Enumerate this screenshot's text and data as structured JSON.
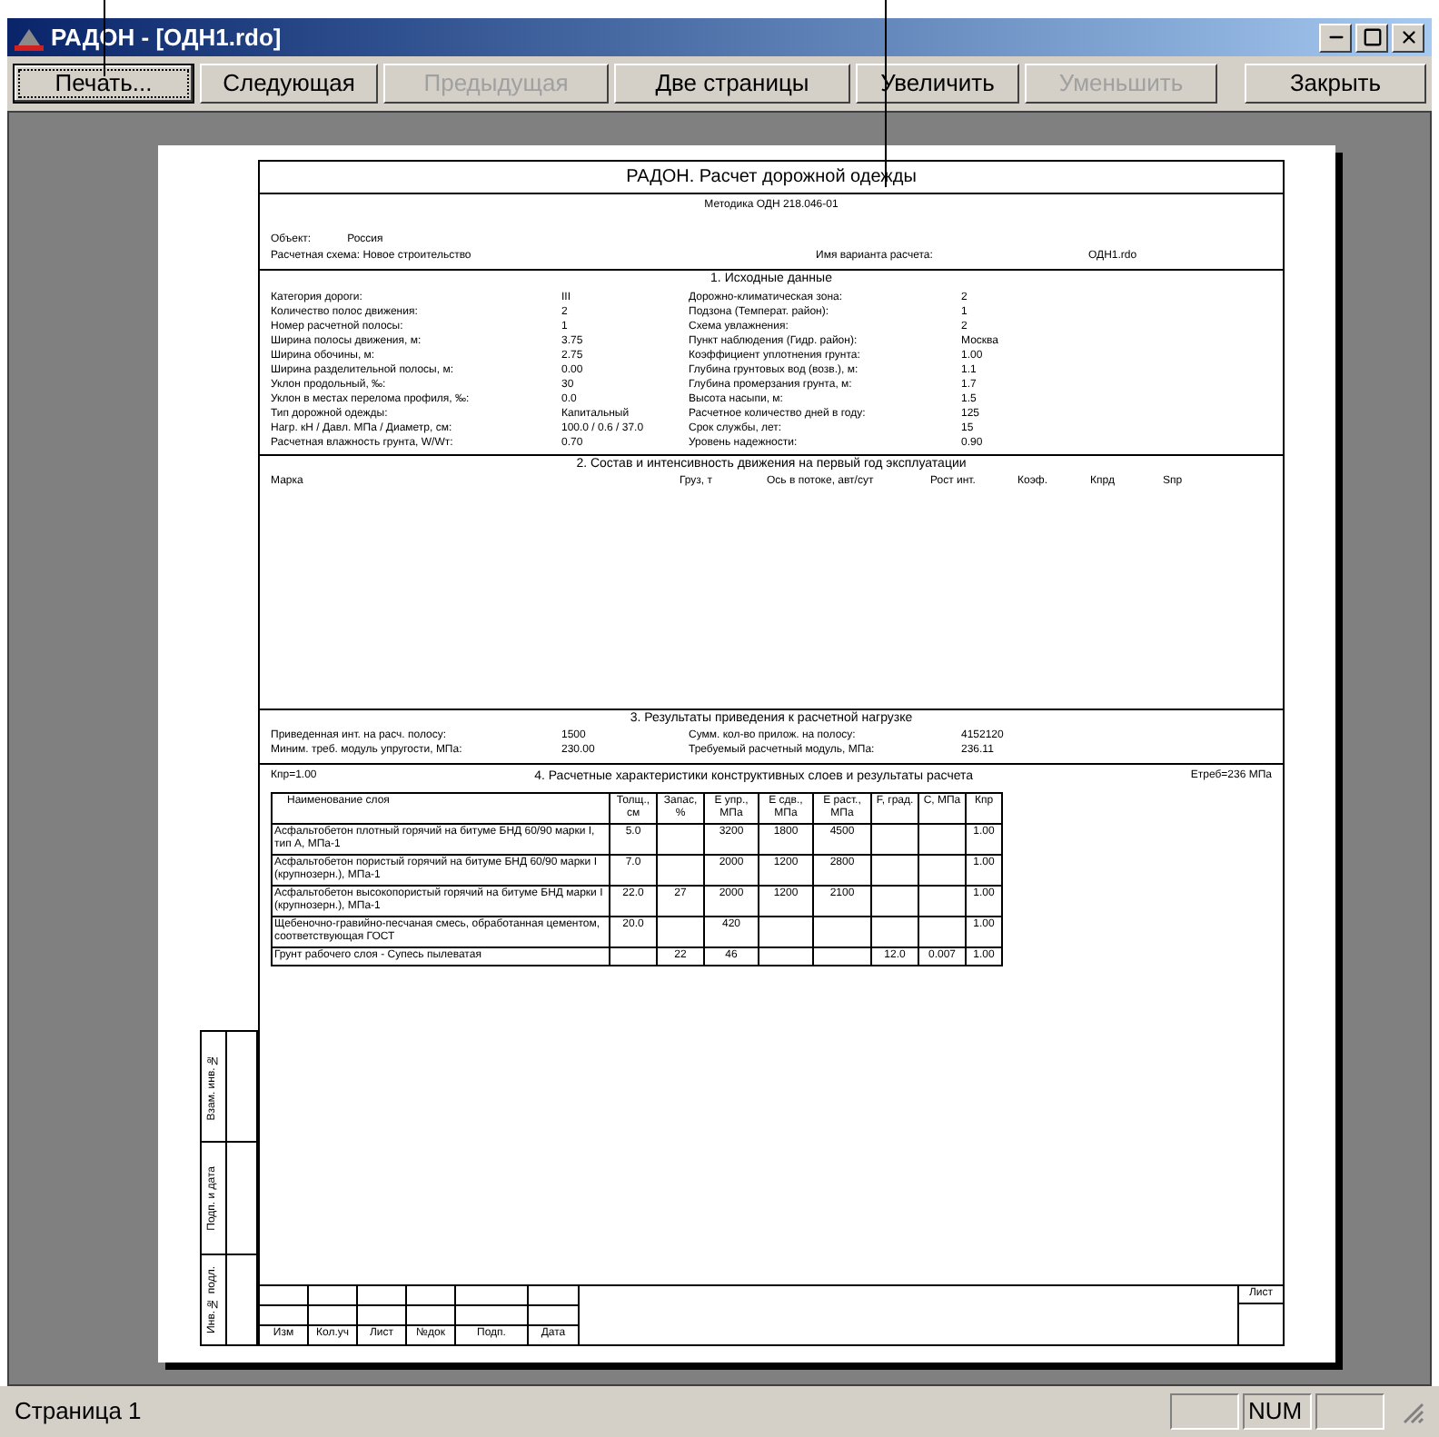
{
  "window": {
    "title": "РАДОН - [ОДН1.rdo]"
  },
  "toolbar": [
    {
      "label": "Печать...",
      "disabled": false,
      "focused": true
    },
    {
      "label": "Следующая",
      "disabled": false,
      "focused": false
    },
    {
      "label": "Предыдущая",
      "disabled": true,
      "focused": false
    },
    {
      "label": "Две страницы",
      "disabled": false,
      "focused": false
    },
    {
      "label": "Увеличить",
      "disabled": false,
      "focused": false
    },
    {
      "label": "Уменьшить",
      "disabled": true,
      "focused": false
    },
    {
      "label": "Закрыть",
      "disabled": false,
      "focused": false
    }
  ],
  "document": {
    "title": "РАДОН. Расчет дорожной одежды",
    "method": "Методика ОДН 218.046-01",
    "object_label": "Объект:",
    "object_value": "Россия",
    "scheme": "Расчетная схема: Новое строительство",
    "variant_label": "Имя варианта расчета:",
    "variant_value": "ОДН1.rdo",
    "section1": {
      "title": "1. Исходные данные",
      "rows": [
        {
          "label": "Категория дороги:",
          "value": "III",
          "label2": "Дорожно-климатическая зона:",
          "value2": "2"
        },
        {
          "label": "Количество полос движения:",
          "value": "2",
          "label2": "Подзона (Температ. район):",
          "value2": "1"
        },
        {
          "label": "Номер расчетной полосы:",
          "value": "1",
          "label2": "Схема увлажнения:",
          "value2": "2"
        },
        {
          "label": "Ширина полосы движения, м:",
          "value": "3.75",
          "label2": "Пункт наблюдения (Гидр. район):",
          "value2": "Москва"
        },
        {
          "label": "Ширина обочины, м:",
          "value": "2.75",
          "label2": "Коэффициент уплотнения грунта:",
          "value2": "1.00"
        },
        {
          "label": "Ширина разделительной полосы, м:",
          "value": "0.00",
          "label2": "Глубина грунтовых вод (возв.), м:",
          "value2": "1.1"
        },
        {
          "label": "Уклон продольный, ‰:",
          "value": "30",
          "label2": "Глубина промерзания грунта, м:",
          "value2": "1.7"
        },
        {
          "label": "Уклон в местах перелома профиля, ‰:",
          "value": "0.0",
          "label2": "Высота насыпи, м:",
          "value2": "1.5"
        },
        {
          "label": "Тип дорожной одежды:",
          "value": "Капитальный",
          "label2": "Расчетное количество дней в году:",
          "value2": "125"
        },
        {
          "label": "Нагр. кН / Давл. МПа / Диаметр, см:",
          "value": "100.0 / 0.6 / 37.0",
          "label2": "Срок службы, лет:",
          "value2": "15"
        },
        {
          "label": "Расчетная влажность грунта, W/Wт:",
          "value": "0.70",
          "label2": "Уровень надежности:",
          "value2": "0.90"
        }
      ]
    },
    "section2": {
      "title": "2. Состав и интенсивность движения на первый год эксплуатации",
      "columns": [
        "Марка",
        "Груз, т",
        "Ось в потоке, авт/сут",
        "Рост инт.",
        "Коэф.",
        "Кпрд",
        "Sпр"
      ]
    },
    "section3": {
      "title": "3. Результаты приведения к расчетной нагрузке",
      "rows": [
        {
          "label": "Приведенная инт. на расч. полосу:",
          "value": "1500",
          "label2": "Сумм. кол-во прилож. на полосу:",
          "value2": "4152120"
        },
        {
          "label": "Миним. треб. модуль упругости, МПа:",
          "value": "230.00",
          "label2": "Требуемый расчетный модуль, МПа:",
          "value2": "236.11"
        }
      ]
    },
    "section4": {
      "left": "Кпр=1.00",
      "title": "4. Расчетные характеристики конструктивных слоев и результаты расчета",
      "right": "Eтреб=236 МПа",
      "columns": [
        "Наименование слоя",
        "Толщ., см",
        "Запас, %",
        "Е упр., МПа",
        "Е сдв., МПа",
        "Е раст., МПа",
        "F, град.",
        "C, МПа",
        "Кпр"
      ],
      "rows": [
        [
          "Асфальтобетон плотный горячий на битуме БНД 60/90 марки I, тип А, МПа-1",
          "5.0",
          "",
          "3200",
          "1800",
          "4500",
          "",
          "",
          "1.00"
        ],
        [
          "Асфальтобетон пористый горячий на битуме БНД 60/90 марки I (крупнозерн.), МПа-1",
          "7.0",
          "",
          "2000",
          "1200",
          "2800",
          "",
          "",
          "1.00"
        ],
        [
          "Асфальтобетон высокопористый горячий на битуме БНД марки I (крупнозерн.), МПа-1",
          "22.0",
          "27",
          "2000",
          "1200",
          "2100",
          "",
          "",
          "1.00"
        ],
        [
          "Щебеночно-гравийно-песчаная смесь, обработанная цементом, соответствующая ГОСТ",
          "20.0",
          "",
          "420",
          "",
          "",
          "",
          "",
          "1.00"
        ],
        [
          "Грунт рабочего слоя - Супесь пылеватая",
          "",
          "22",
          "46",
          "",
          "",
          "12.0",
          "0.007",
          "1.00"
        ]
      ]
    },
    "side_stamp": [
      "Взам. инв. №",
      "Подп. и дата",
      "Инв. № подл."
    ],
    "stamp_columns": [
      "Изм",
      "Кол.уч",
      "Лист",
      "№док",
      "Подп.",
      "Дата"
    ],
    "sheet_label": "Лист"
  },
  "status_bar": {
    "page": "Страница 1",
    "indicators": [
      {
        "kind": "blank"
      },
      {
        "kind": "text",
        "text": "NUM"
      },
      {
        "kind": "blank"
      }
    ]
  }
}
